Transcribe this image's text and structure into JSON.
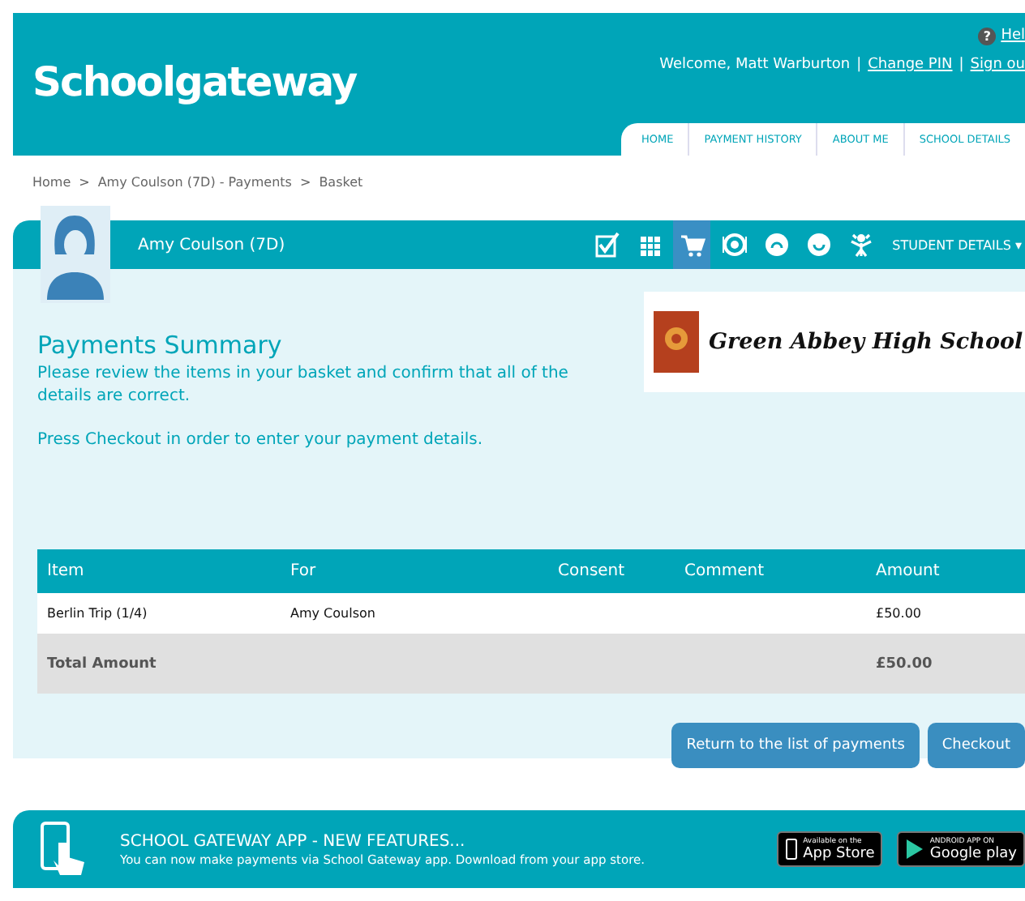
{
  "header": {
    "logo": "Schoolgateway",
    "help_mark": "?",
    "help_link": "Hel",
    "separator": "|",
    "welcome": "Welcome, Matt Warburton",
    "links": [
      "Change PIN",
      "Sign ou"
    ],
    "tabs": [
      {
        "label": "HOME",
        "selected": false
      },
      {
        "label": "PAYMENT HISTORY",
        "selected": false
      },
      {
        "label": "ABOUT ME",
        "selected": false
      },
      {
        "label": "SCHOOL DETAILS",
        "selected": false
      }
    ]
  },
  "breadcrumb": {
    "separator": ">",
    "items": [
      "Home",
      "Amy Coulson (7D) - Payments",
      "Basket"
    ]
  },
  "student_bar": {
    "name": "Amy Coulson (7D)",
    "icons": [
      {
        "kind": "check",
        "selected": false
      },
      {
        "kind": "calendar",
        "selected": false
      },
      {
        "kind": "cart",
        "selected": true
      },
      {
        "kind": "coin",
        "selected": false
      },
      {
        "kind": "sad",
        "selected": false
      },
      {
        "kind": "smile",
        "selected": false
      },
      {
        "kind": "figure",
        "selected": false
      }
    ],
    "details_label": "STUDENT DETAILS",
    "caret": "▾"
  },
  "summary": {
    "title": "Payments Summary",
    "intro": "Please review the items in your basket and confirm that all of the details are correct.",
    "note": "Press Checkout in order to enter your payment details.",
    "school_name": "Green Abbey High School"
  },
  "table": {
    "columns": [
      "Item",
      "For",
      "Consent",
      "Comment",
      "Amount"
    ],
    "rows": [
      [
        "Berlin Trip (1/4)",
        "Amy Coulson",
        "",
        "",
        "£50.00"
      ]
    ],
    "total": {
      "label": "Total Amount",
      "amount": "£50.00"
    }
  },
  "buttons": [
    "Return to the list of payments",
    "Checkout"
  ],
  "footer": {
    "title": "SCHOOL GATEWAY APP - NEW FEATURES...",
    "text": "You can now make payments via School Gateway app. Download from your app store.",
    "badges": [
      {
        "kind": "apple",
        "small": "Available on the",
        "big": "App Store"
      },
      {
        "kind": "android",
        "small": "ANDROID APP ON",
        "big": "Google play"
      }
    ]
  }
}
